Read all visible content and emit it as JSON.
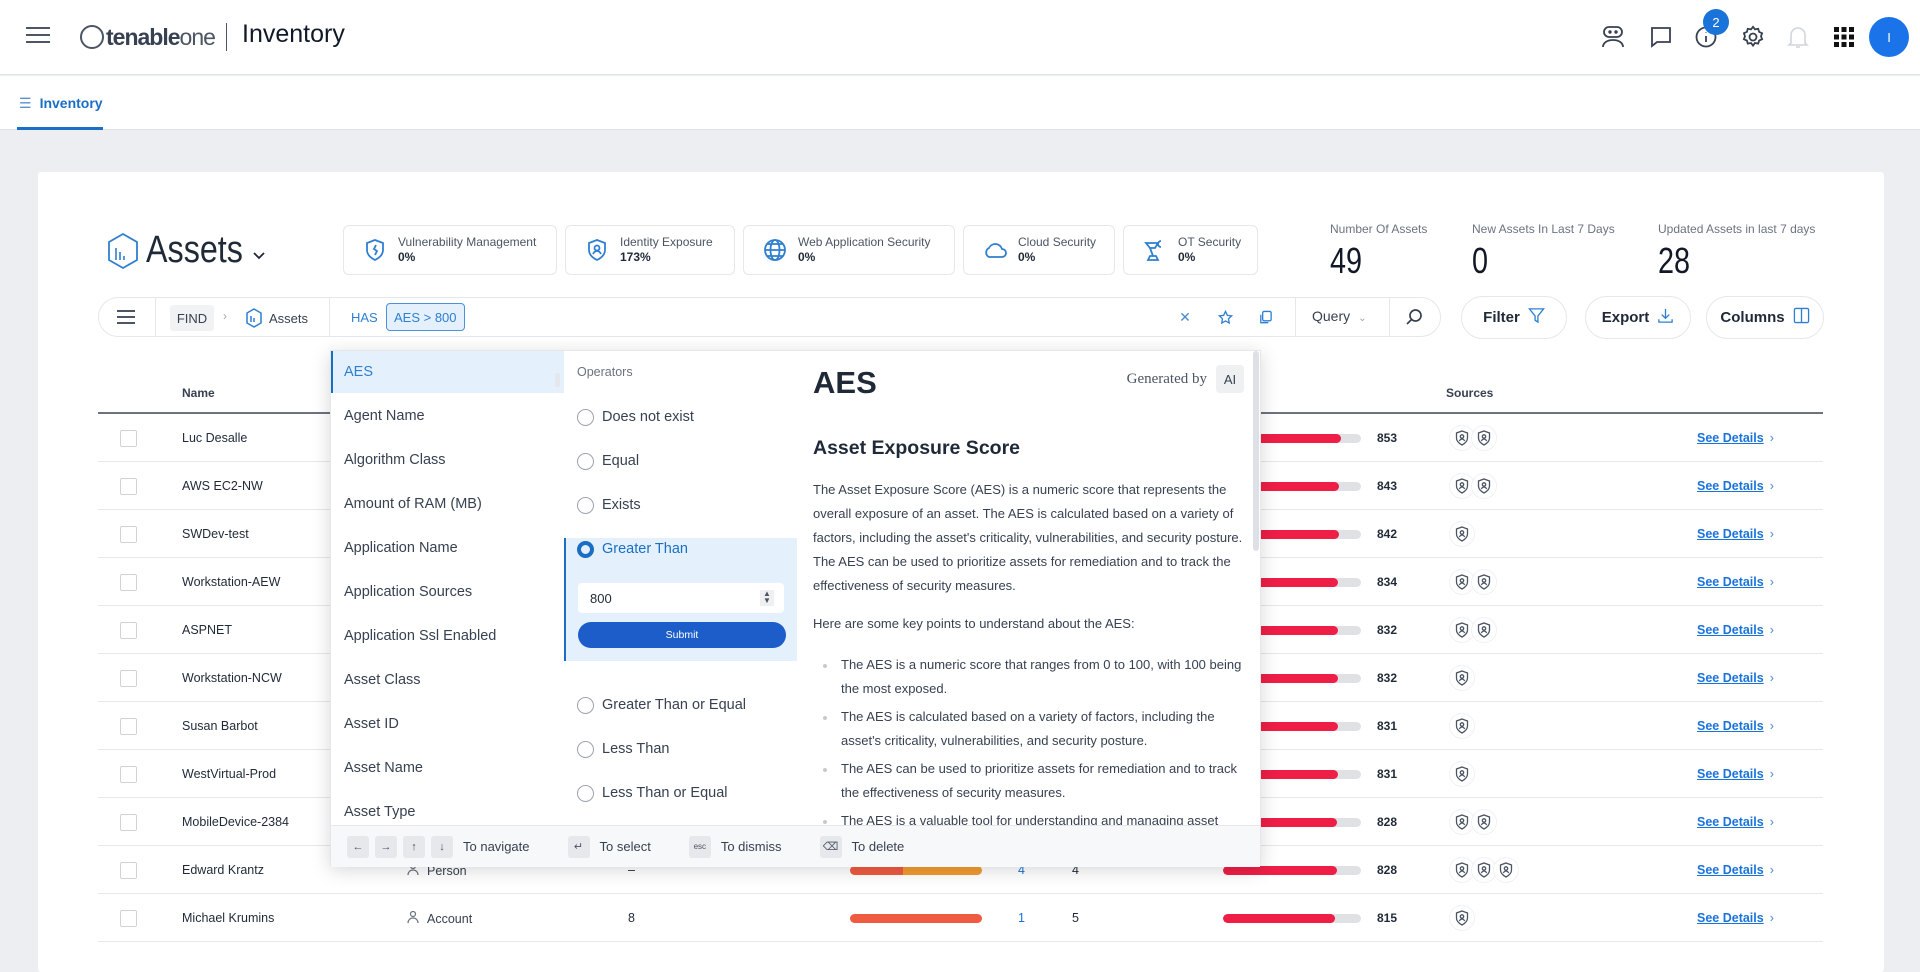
{
  "header": {
    "brand": "tenable",
    "brand_suffix": "one",
    "app_title": "Inventory",
    "notification_count": "2",
    "avatar_initial": "I"
  },
  "subnav": {
    "tab": "Inventory"
  },
  "page": {
    "title": "Assets"
  },
  "chips": [
    {
      "label": "Vulnerability Management",
      "value": "0%",
      "icon": "shield-icon"
    },
    {
      "label": "Identity Exposure",
      "value": "173%",
      "icon": "identity-shield-icon"
    },
    {
      "label": "Web Application Security",
      "value": "0%",
      "icon": "globe-icon"
    },
    {
      "label": "Cloud Security",
      "value": "0%",
      "icon": "cloud-icon"
    },
    {
      "label": "OT Security",
      "value": "0%",
      "icon": "robot-arm-icon"
    }
  ],
  "stats": [
    {
      "label": "Number Of Assets",
      "value": "49"
    },
    {
      "label": "New Assets In Last 7 Days",
      "value": "0"
    },
    {
      "label": "Updated Assets in last 7 days",
      "value": "28"
    }
  ],
  "search": {
    "find": "FIND",
    "object": "Assets",
    "has": "HAS",
    "tag": "AES > 800",
    "mode": "Query"
  },
  "buttons": {
    "filter": "Filter",
    "export": "Export",
    "columns": "Columns"
  },
  "table": {
    "headers": {
      "name": "Name",
      "sources": "Sources"
    },
    "see_details": "See Details",
    "rows": [
      {
        "name": "Luc Desalle",
        "aes": 853,
        "sources": 2
      },
      {
        "name": "AWS EC2-NW",
        "aes": 843,
        "sources": 2
      },
      {
        "name": "SWDev-test",
        "aes": 842,
        "sources": 1
      },
      {
        "name": "Workstation-AEW",
        "aes": 834,
        "sources": 2
      },
      {
        "name": "ASPNET",
        "aes": 832,
        "sources": 2
      },
      {
        "name": "Workstation-NCW",
        "aes": 832,
        "sources": 1
      },
      {
        "name": "Susan Barbot",
        "aes": 831,
        "sources": 1
      },
      {
        "name": "WestVirtual-Prod",
        "aes": 831,
        "sources": 1
      },
      {
        "name": "MobileDevice-2384",
        "aes": 828,
        "sources": 2
      },
      {
        "name": "Edward Krantz",
        "aes": 828,
        "sources": 3,
        "type": "Person",
        "col3": "–",
        "col4": "4",
        "col5": "4"
      },
      {
        "name": "Michael Krumins",
        "aes": 815,
        "sources": 1,
        "type": "Account",
        "col3": "8",
        "col4": "1",
        "col5": "5"
      }
    ]
  },
  "popup": {
    "attributes": [
      "AES",
      "Agent Name",
      "Algorithm Class",
      "Amount of RAM (MB)",
      "Application Name",
      "Application Sources",
      "Application Ssl Enabled",
      "Asset Class",
      "Asset ID",
      "Asset Name",
      "Asset Type"
    ],
    "operators_title": "Operators",
    "operators": [
      "Does not exist",
      "Equal",
      "Exists",
      "Greater Than",
      "Greater Than or Equal",
      "Less Than",
      "Less Than or Equal"
    ],
    "selected_operator": "Greater Than",
    "value": "800",
    "submit": "Submit",
    "desc_title": "AES",
    "generated_by": "Generated by",
    "ai": "AI",
    "desc_subtitle": "Asset Exposure Score",
    "desc_paragraph": "The Asset Exposure Score (AES) is a numeric score that represents the overall exposure of an asset. The AES is calculated based on a variety of factors, including the asset's criticality, vulnerabilities, and security posture. The AES can be used to prioritize assets for remediation and to track the effectiveness of security measures.",
    "desc_intro": "Here are some key points to understand about the AES:",
    "desc_bullets": [
      "The AES is a numeric score that ranges from 0 to 100, with 100 being the most exposed.",
      "The AES is calculated based on a variety of factors, including the asset's criticality, vulnerabilities, and security posture.",
      "The AES can be used to prioritize assets for remediation and to track the effectiveness of security measures.",
      "The AES is a valuable tool for understanding and managing asset exposure."
    ],
    "footer": {
      "navigate": "To navigate",
      "select": "To select",
      "dismiss": "To dismiss",
      "delete": "To delete",
      "esc": "esc"
    }
  },
  "colors": {
    "accent": "#1a6fc4",
    "aes_bar": "#ee1e47",
    "severity_high": "#f05a40",
    "severity_medium": "#f39b30"
  }
}
